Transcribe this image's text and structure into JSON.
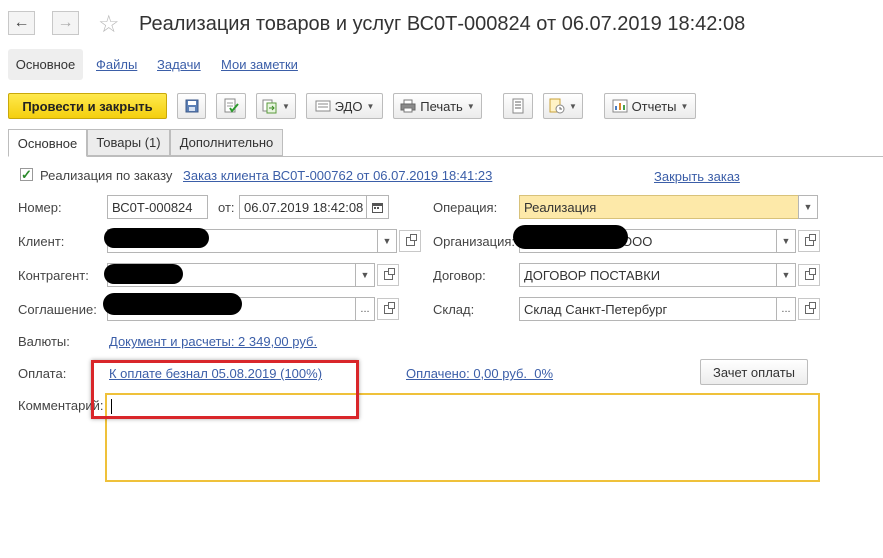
{
  "window": {
    "title": "Реализация товаров и услуг ВС0Т-000824 от 06.07.2019 18:42:08"
  },
  "sections": {
    "main": "Основное",
    "files": "Файлы",
    "tasks": "Задачи",
    "notes": "Мои заметки"
  },
  "toolbar": {
    "post_close": "Провести и закрыть",
    "edo": "ЭДО",
    "print": "Печать",
    "reports": "Отчеты"
  },
  "tabs": [
    "Основное",
    "Товары (1)",
    "Дополнительно"
  ],
  "form": {
    "by_order_label": "Реализация по заказу",
    "by_order_checked": true,
    "order_link": "Заказ клиента ВС0Т-000762 от 06.07.2019 18:41:23",
    "close_order": "Закрыть заказ",
    "number_label": "Номер:",
    "number_value": "ВС0Т-000824",
    "from_label": "от:",
    "date_value": "06.07.2019 18:42:08",
    "operation_label": "Операция:",
    "operation_value": "Реализация",
    "client_label": "Клиент:",
    "org_label": "Организация:",
    "org_value_suffix": "ООО",
    "counterparty_label": "Контрагент:",
    "contract_label": "Договор:",
    "contract_value": "ДОГОВОР ПОСТАВКИ",
    "agreement_label": "Соглашение:",
    "warehouse_label": "Склад:",
    "warehouse_value": "Склад Санкт-Петербург",
    "currency_label": "Валюты:",
    "currency_link": "Документ и расчеты: 2 349,00 руб.",
    "payment_label": "Оплата:",
    "payment_link": "К оплате безнал 05.08.2019 (100%)",
    "paid_link": "Оплачено: 0,00 руб.  0%",
    "offset_button": "Зачет оплаты",
    "comment_label": "Комментарий:",
    "comment_value": ""
  },
  "colors": {
    "primary_button": "#f4cf0e",
    "link": "#3b5ea8",
    "highlight_field": "#fde9a9",
    "comment_border": "#efc13a",
    "annotation_box": "#d9262a"
  }
}
